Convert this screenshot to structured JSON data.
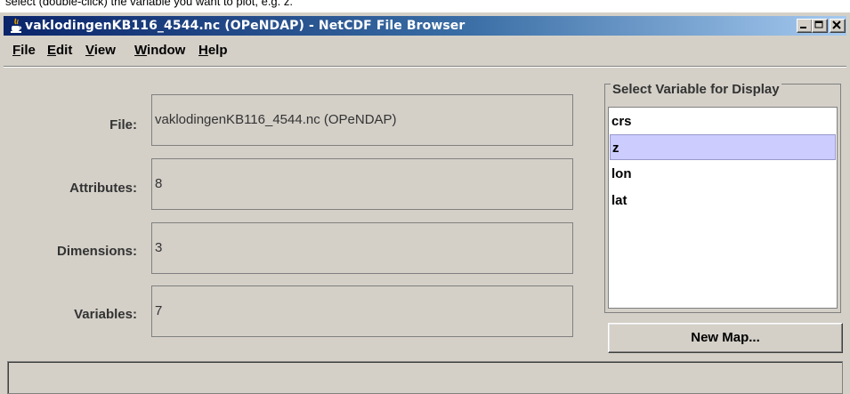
{
  "caption": "select (double-click) the variable you want to plot, e.g. z.",
  "window": {
    "title": "vaklodingenKB116_4544.nc (OPeNDAP) - NetCDF File Browser",
    "icon": "java-cup-icon",
    "controls": [
      "minimize-icon",
      "maximize-icon",
      "close-icon"
    ]
  },
  "menu": [
    {
      "mnemonic": "F",
      "rest": "ile"
    },
    {
      "mnemonic": "E",
      "rest": "dit"
    },
    {
      "mnemonic": "V",
      "rest": "iew"
    },
    {
      "mnemonic": "W",
      "rest": "indow"
    },
    {
      "mnemonic": "H",
      "rest": "elp"
    }
  ],
  "info": {
    "file": {
      "label": "File:",
      "value": "vaklodingenKB116_4544.nc (OPeNDAP)"
    },
    "attributes": {
      "label": "Attributes:",
      "value": "8"
    },
    "dimensions": {
      "label": "Dimensions:",
      "value": "3"
    },
    "variables": {
      "label": "Variables:",
      "value": "7"
    }
  },
  "variable_panel": {
    "title": "Select Variable for Display",
    "items": [
      "crs",
      "z",
      "lon",
      "lat"
    ],
    "selected": "z",
    "selection_color": "#ccccff"
  },
  "new_map_button": "New Map..."
}
